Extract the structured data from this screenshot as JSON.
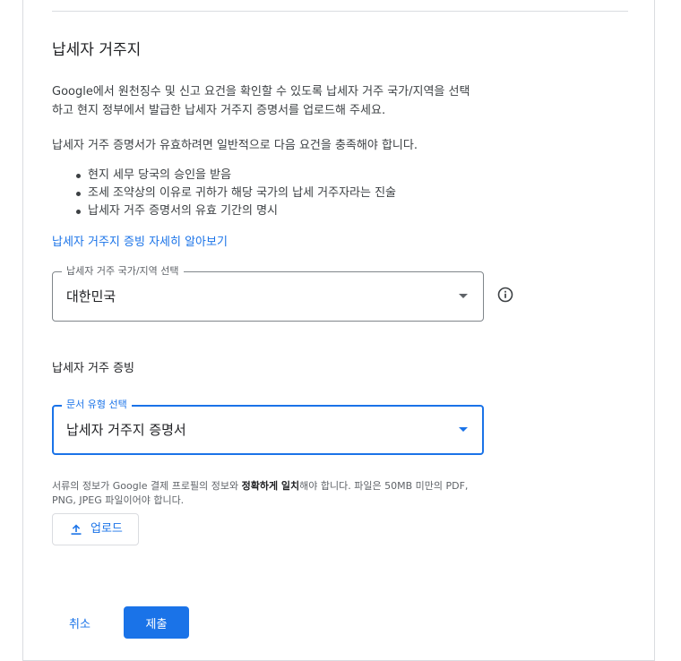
{
  "section": {
    "title": "납세자 거주지",
    "intro_line1": "Google에서 원천징수 및 신고 요건을 확인할 수 있도록 납세자 거주 국가/지역을 선택",
    "intro_line2": "하고 현지 정부에서 발급한 납세자 거주지 증명서를 업로드해 주세요.",
    "requirements_intro": "납세자 거주 증명서가 유효하려면 일반적으로 다음 요건을 충족해야 합니다.",
    "requirements": [
      "현지 세무 당국의 승인을 받음",
      "조세 조약상의 이유로 귀하가 해당 국가의 납세 거주자라는 진술",
      "납세자 거주 증명서의 유효 기간의 명시"
    ],
    "learn_more_link": "납세자 거주지 증빙 자세히 알아보기"
  },
  "country_select": {
    "label": "납세자 거주 국가/지역 선택",
    "value": "대한민국",
    "info_icon": "info-icon"
  },
  "proof": {
    "title": "납세자 거주 증빙",
    "doc_type_select": {
      "label": "문서 유형 선택",
      "value": "납세자 거주지 증명서"
    },
    "note_part1": "서류의 정보가 Google 결제 프로필의 정보와 ",
    "note_bold": "정확하게 일치",
    "note_part2": "해야 합니다. 파일은 50MB 미만의 PDF,",
    "note_line2": "PNG, JPEG 파일이어야 합니다.",
    "upload_label": "업로드",
    "upload_icon": "upload-icon"
  },
  "actions": {
    "cancel_label": "취소",
    "submit_label": "제출"
  },
  "colors": {
    "accent": "#1a73e8",
    "text": "#202124",
    "secondary_text": "#5f6368",
    "border": "#dadce0"
  }
}
